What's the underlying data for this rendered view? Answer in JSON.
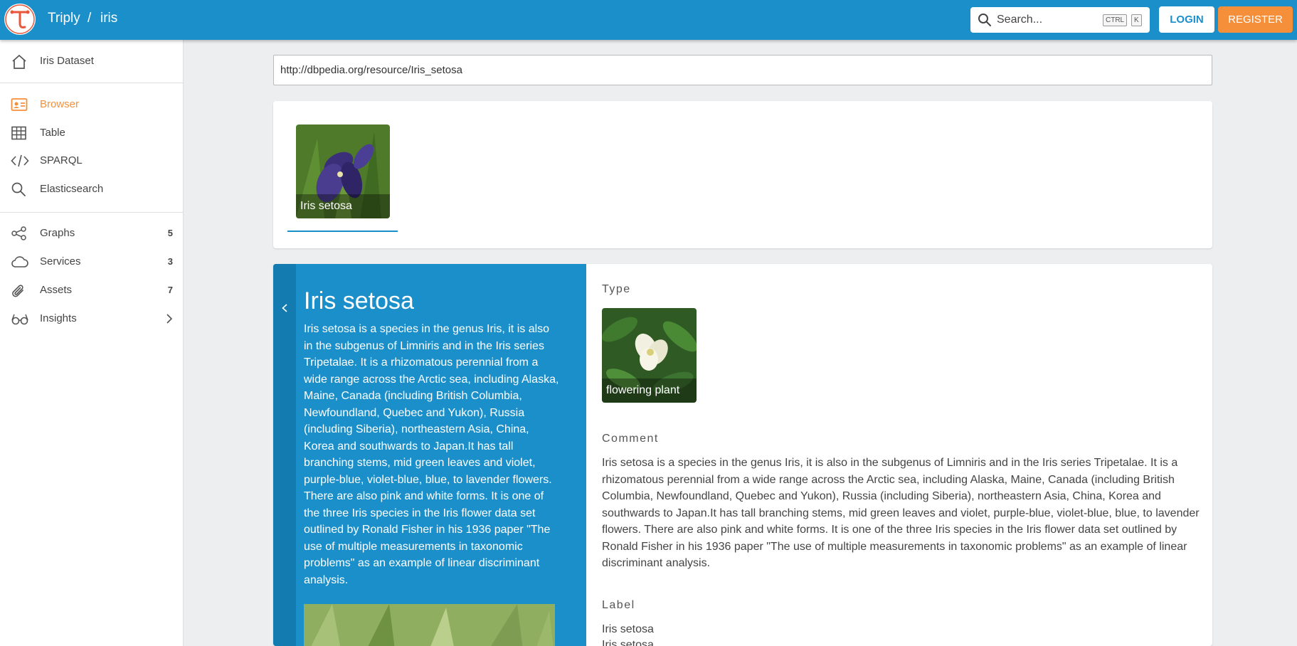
{
  "header": {
    "site": "Triply",
    "separator": "/",
    "dataset": "iris",
    "search_placeholder": "Search...",
    "shortcut_ctrl": "CTRL",
    "shortcut_key": "K",
    "login": "LOGIN",
    "register": "REGISTER",
    "brand_color": "#1a8fc9",
    "accent_color": "#f68f3a"
  },
  "sidebar": {
    "dataset_link": "Iris Dataset",
    "items": [
      {
        "label": "Browser",
        "icon": "browser-icon",
        "active": true
      },
      {
        "label": "Table",
        "icon": "table-icon"
      },
      {
        "label": "SPARQL",
        "icon": "code-icon"
      },
      {
        "label": "Elasticsearch",
        "icon": "search-icon"
      }
    ],
    "sections": [
      {
        "label": "Graphs",
        "count": "5",
        "icon": "graph-icon"
      },
      {
        "label": "Services",
        "count": "3",
        "icon": "cloud-icon"
      },
      {
        "label": "Assets",
        "count": "7",
        "icon": "paperclip-icon"
      },
      {
        "label": "Insights",
        "icon": "glasses-icon"
      }
    ]
  },
  "resource": {
    "iri": "http://dbpedia.org/resource/Iris_setosa",
    "gallery": [
      {
        "caption": "Iris setosa"
      }
    ],
    "title": "Iris setosa",
    "description": "Iris setosa is a species in the genus Iris, it is also in the subgenus of Limniris and in the Iris series Tripetalae. It is a rhizomatous perennial from a wide range across the Arctic sea, including Alaska, Maine, Canada (including British Columbia, Newfoundland, Quebec and Yukon), Russia (including Siberia), northeastern Asia, China, Korea and southwards to Japan.It has tall branching stems, mid green leaves and violet, purple-blue, violet-blue, blue, to lavender flowers. There are also pink and white forms. It is one of the three Iris species in the Iris flower data set outlined by Ronald Fisher in his 1936 paper \"The use of multiple measurements in taxonomic problems\" as an example of linear discriminant analysis.",
    "properties": {
      "type_label": "Type",
      "type_value": "flowering plant",
      "comment_label": "Comment",
      "comment_value": "Iris setosa is a species in the genus Iris, it is also in the subgenus of Limniris and in the Iris series Tripetalae. It is a rhizomatous perennial from a wide range across the Arctic sea, including Alaska, Maine, Canada (including British Columbia, Newfoundland, Quebec and Yukon), Russia (including Siberia), northeastern Asia, China, Korea and southwards to Japan.It has tall branching stems, mid green leaves and violet, purple-blue, violet-blue, blue, to lavender flowers. There are also pink and white forms. It is one of the three Iris species in the Iris flower data set outlined by Ronald Fisher in his 1936 paper \"The use of multiple measurements in taxonomic problems\" as an example of linear discriminant analysis.",
      "label_label": "Label",
      "label_values": [
        "Iris setosa",
        "Iris setosa"
      ]
    }
  }
}
